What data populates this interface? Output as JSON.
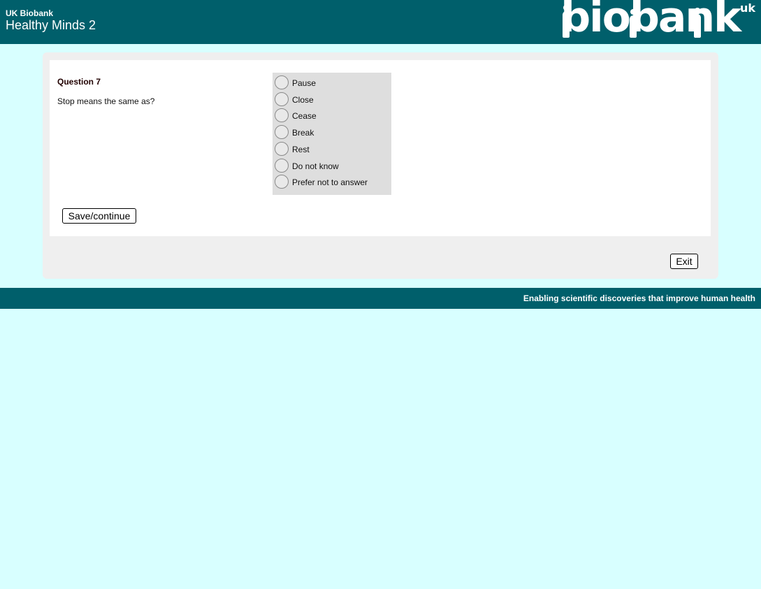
{
  "header": {
    "org": "UK Biobank",
    "title": "Healthy Minds 2",
    "logo_text": "biobank",
    "logo_suffix": "uk",
    "background_color": "#005f6b"
  },
  "question": {
    "number_label": "Question 7",
    "text": "Stop means the same as?",
    "options": [
      {
        "label": "Pause"
      },
      {
        "label": "Close"
      },
      {
        "label": "Cease"
      },
      {
        "label": "Break"
      },
      {
        "label": "Rest"
      },
      {
        "label": "Do not know"
      },
      {
        "label": "Prefer not to answer"
      }
    ]
  },
  "buttons": {
    "save_label": "Save/continue",
    "exit_label": "Exit"
  },
  "footer": {
    "tagline": "Enabling scientific discoveries that improve human health"
  },
  "colors": {
    "page_background": "#d8ffff",
    "brand": "#005f6b",
    "panel": "#efefef"
  }
}
